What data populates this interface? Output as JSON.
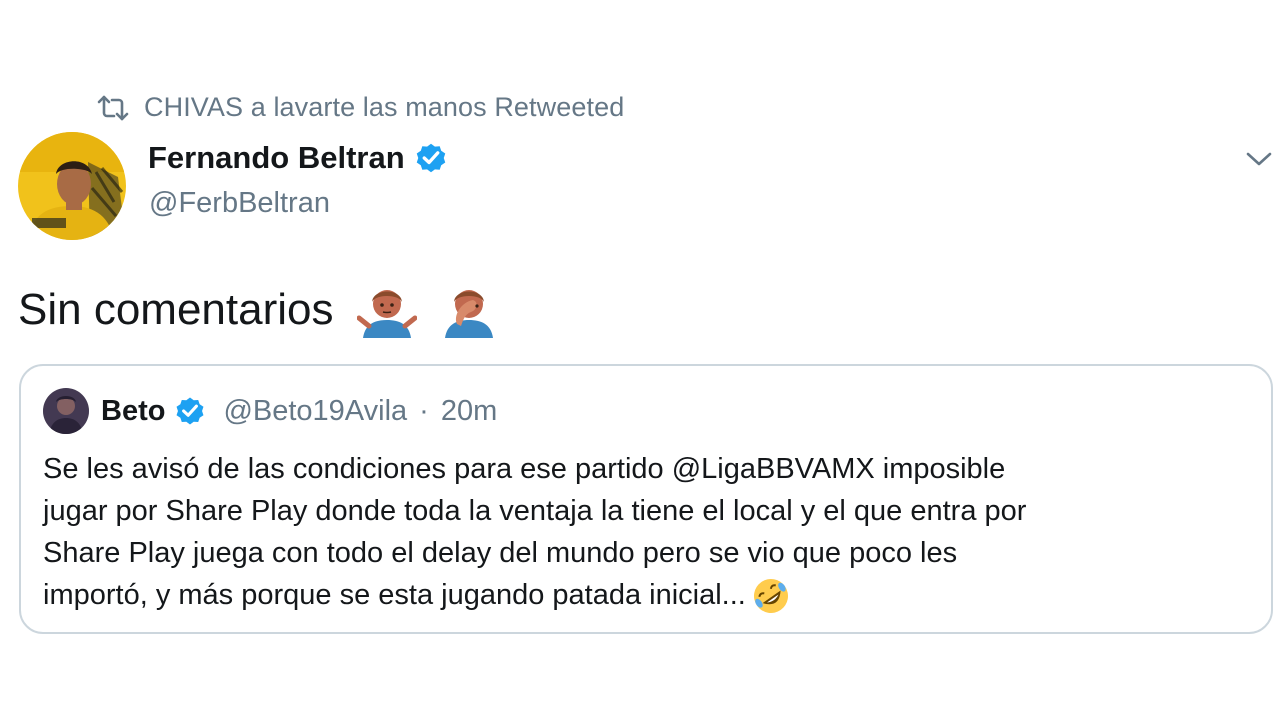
{
  "retweet": {
    "icon": "retweet-icon",
    "text": "CHIVAS a lavarte las manos Retweeted"
  },
  "author": {
    "name": "Fernando Beltran",
    "handle": "@FerbBeltran",
    "verified": true,
    "avatar_icon": "avatar-image"
  },
  "tweet": {
    "text": "Sin comentarios",
    "emojis": [
      "man-shrugging-emoji",
      "man-facepalming-emoji"
    ]
  },
  "quoted": {
    "name": "Beto",
    "handle": "@Beto19Avila",
    "separator": "·",
    "time": "20m",
    "verified": true,
    "lines": [
      "Se les avisó de las condiciones para ese partido @LigaBBVAMX imposible",
      "jugar por Share Play donde toda la ventaja la tiene el local y el que entra por",
      "Share Play juega con todo el delay del mundo pero se vio que poco les",
      "importó, y más porque se esta jugando patada inicial..."
    ],
    "emoji": "rolling-on-floor-laughing-emoji"
  },
  "colors": {
    "text_primary": "#14171a",
    "text_secondary": "#657786",
    "verified_blue": "#1da1f2",
    "card_border": "#ccd6dd"
  }
}
